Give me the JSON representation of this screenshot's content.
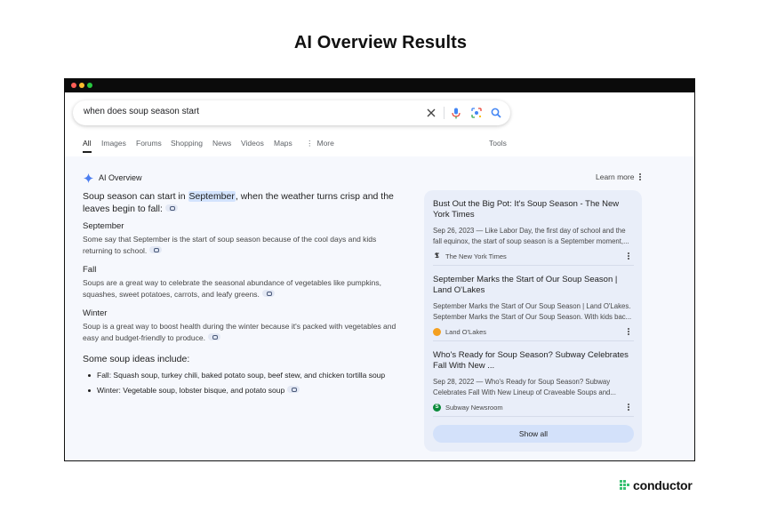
{
  "page_title": "AI Overview Results",
  "window": {
    "dot_colors": [
      "#ff5f57",
      "#febc2e",
      "#28c840"
    ]
  },
  "search": {
    "query": "when does soup season start",
    "clear_icon": "close-icon",
    "voice_icon": "microphone-icon",
    "lens_icon": "camera-lens-icon",
    "search_icon": "search-icon"
  },
  "tabs": [
    "All",
    "Images",
    "Forums",
    "Shopping",
    "News",
    "Videos",
    "Maps",
    "More"
  ],
  "tools_label": "Tools",
  "ai_overview": {
    "label": "AI Overview",
    "learn_more": "Learn more",
    "lede_before": "Soup season can start in ",
    "lede_highlight": "September",
    "lede_after": ", when the weather turns crisp and the leaves begin to fall:",
    "sections": [
      {
        "title": "September",
        "body": "Some say that September is the start of soup season because of the cool days and kids returning to school."
      },
      {
        "title": "Fall",
        "body": "Soups are a great way to celebrate the seasonal abundance of vegetables like pumpkins, squashes, sweet potatoes, carrots, and leafy greens."
      },
      {
        "title": "Winter",
        "body": "Soup is a great way to boost health during the winter because it's packed with vegetables and easy and budget-friendly to produce."
      }
    ],
    "ideas_title": "Some soup ideas include:",
    "ideas": [
      "Fall: Squash soup, turkey chili, baked potato soup, beef stew, and chicken tortilla soup",
      "Winter: Vegetable soup, lobster bisque, and potato soup"
    ]
  },
  "sources": [
    {
      "title": "Bust Out the Big Pot: It's Soup Season - The New York Times",
      "snippet": "Sep 26, 2023 — Like Labor Day, the first day of school and the fall equinox, the start of soup season is a September moment,...",
      "site": "The New York Times",
      "favicon": "𝕿",
      "favicon_color": "#111111"
    },
    {
      "title": "September Marks the Start of Our Soup Season | Land O'Lakes",
      "snippet": "September Marks the Start of Our Soup Season | Land O'Lakes. September Marks the Start of Our Soup Season. With kids bac...",
      "site": "Land O'Lakes",
      "favicon": "",
      "favicon_color": "#f4a020"
    },
    {
      "title": "Who's Ready for Soup Season? Subway Celebrates Fall With New ...",
      "snippet": "Sep 28, 2022 — Who's Ready for Soup Season? Subway Celebrates Fall With New Lineup of Craveable Soups and...",
      "site": "Subway Newsroom",
      "favicon": "S",
      "favicon_color": "#0a8a3a"
    }
  ],
  "show_all": "Show all",
  "brand": {
    "name": "conductor",
    "color": "#38c172"
  }
}
